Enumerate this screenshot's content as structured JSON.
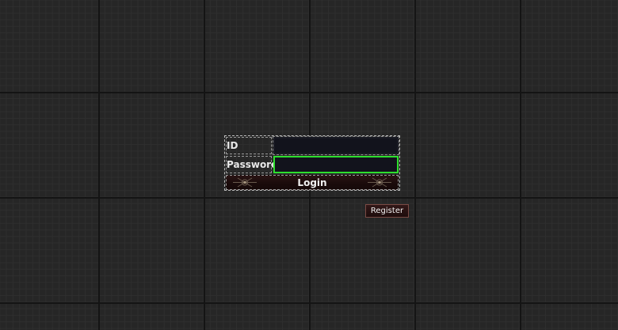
{
  "login_form": {
    "id_label": "ID",
    "id_value": "",
    "password_label": "Password",
    "password_value": "",
    "login_label": "Login"
  },
  "register_label": "Register",
  "colors": {
    "background": "#262626",
    "focus_border": "#2ede2e",
    "button_dark_red": "#1c0c0c",
    "input_background": "#12131c"
  }
}
